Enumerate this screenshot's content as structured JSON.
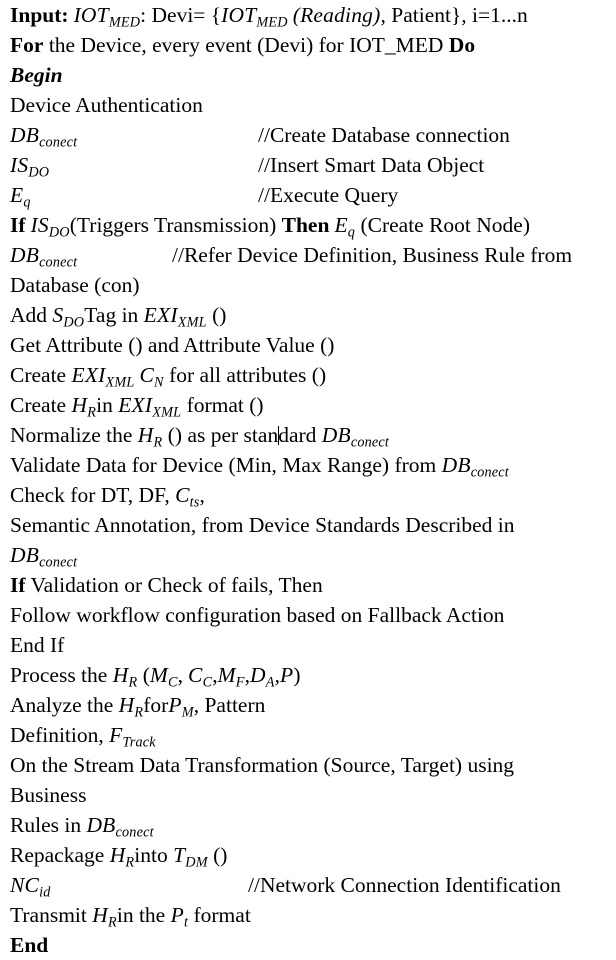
{
  "document": {
    "kind": "algorithm-pseudocode-listing",
    "font_style": "serif",
    "text_color": "#000000",
    "background_color": "#ffffff",
    "caret_visible": true,
    "caret_line_index": 15,
    "caret_after_text": "stan"
  },
  "lines": [
    {
      "id": "line-input",
      "code": "Input: IOT_MED : Devi= {IOT_MED (Reading), Patient}, i=1...n",
      "comment": ""
    },
    {
      "id": "line-for",
      "code": "For the Device, every event (Devi) for IOT_MED Do",
      "comment": ""
    },
    {
      "id": "line-begin",
      "code": "Begin",
      "comment": ""
    },
    {
      "id": "line-device-auth",
      "code": "Device Authentication",
      "comment": ""
    },
    {
      "id": "line-db-conect-1",
      "code": "DB_conect",
      "comment": "//Create Database connection"
    },
    {
      "id": "line-is-do",
      "code": "IS_DO",
      "comment": "//Insert Smart Data Object"
    },
    {
      "id": "line-eq",
      "code": "E_q",
      "comment": "//Execute Query"
    },
    {
      "id": "line-if-isdo",
      "code": "If IS_DO(Triggers Transmission) Then E_q (Create Root Node)",
      "comment": ""
    },
    {
      "id": "line-db-conect-2",
      "code": "DB_conect",
      "comment": "//Refer Device Definition, Business Rule from"
    },
    {
      "id": "line-database-con",
      "code": "Database (con)",
      "comment": ""
    },
    {
      "id": "line-add-sdo-tag",
      "code": "Add S_DO Tag in EXI_XML ()",
      "comment": ""
    },
    {
      "id": "line-get-attribute",
      "code": "Get Attribute () and Attribute Value ()",
      "comment": ""
    },
    {
      "id": "line-create-exi-cn",
      "code": "Create EXI_XML C_N for all attributes ()",
      "comment": ""
    },
    {
      "id": "line-create-hr",
      "code": "Create H_R in EXI_XML format ()",
      "comment": ""
    },
    {
      "id": "line-normalize",
      "code": "Normalize the H_R () as per standard DB_conect",
      "comment": ""
    },
    {
      "id": "line-validate",
      "code": "Validate Data for Device (Min, Max Range) from DB_conect",
      "comment": ""
    },
    {
      "id": "line-check-dt-df",
      "code": "Check for DT, DF, C_ts,",
      "comment": ""
    },
    {
      "id": "line-semantic-annotation",
      "code": "Semantic Annotation, from Device Standards Described in",
      "comment": ""
    },
    {
      "id": "line-db-conect-3",
      "code": "DB_conect",
      "comment": ""
    },
    {
      "id": "line-if-validation",
      "code": "If Validation or Check of fails, Then",
      "comment": ""
    },
    {
      "id": "line-follow-workflow",
      "code": "Follow workflow configuration based on Fallback Action",
      "comment": ""
    },
    {
      "id": "line-end-if",
      "code": "End If",
      "comment": ""
    },
    {
      "id": "line-process-hr",
      "code": "Process the H_R (M_C, C_C, M_F, D_A, P)",
      "comment": ""
    },
    {
      "id": "line-analyze-hr",
      "code": "Analyze the H_R for P_M, Pattern",
      "comment": ""
    },
    {
      "id": "line-definition-ftrack",
      "code": "Definition, F_Track",
      "comment": ""
    },
    {
      "id": "line-stream-transform",
      "code": "On the Stream Data Transformation (Source, Target) using",
      "comment": ""
    },
    {
      "id": "line-business",
      "code": "Business",
      "comment": ""
    },
    {
      "id": "line-rules-in-db",
      "code": "Rules in DB_conect",
      "comment": ""
    },
    {
      "id": "line-repackage",
      "code": "Repackage H_R into T_DM ()",
      "comment": ""
    },
    {
      "id": "line-nc-id",
      "code": "NC_id",
      "comment": "//Network Connection Identification"
    },
    {
      "id": "line-transmit",
      "code": "Transmit H_R in the P_t format",
      "comment": ""
    },
    {
      "id": "line-end",
      "code": "End",
      "comment": ""
    }
  ],
  "tokens": {
    "input_label": "Input:",
    "iot_med": "IOT",
    "iot_med_sub": "MED",
    "devi_eq": ": Devi= {",
    "reading": "(Reading)",
    "patient": ", Patient}, i=1...n",
    "for_label": "For",
    "for_rest": " the Device, every event (Devi) for IOT_MED ",
    "do_label": "Do",
    "begin_label": "Begin",
    "device_auth": "Device Authentication",
    "db": "DB",
    "conect": "conect",
    "is": "IS",
    "do_sub": "DO",
    "e": "E",
    "q_sub": "q",
    "if_label": "If",
    "triggers": "(Triggers Transmission) ",
    "then_label": "Then",
    "create_root_node": " (Create Root Node)",
    "database_con": "Database (con)",
    "add": "Add ",
    "s": "S",
    "tag_in": "Tag in ",
    "exi": "EXI",
    "xml_sub": "XML",
    "parens": " ()",
    "get_attribute": "Get Attribute () and Attribute Value ()",
    "create": "Create ",
    "c": "C",
    "n_sub": "N",
    "for_all_attributes": " for all attributes ()",
    "h": "H",
    "r_sub": "R",
    "in_word": "in ",
    "format": " format ()",
    "normalize_the": "Normalize the ",
    "as_per_standard_a": " () as per stan",
    "as_per_standard_b": "dard ",
    "validate": "Validate Data for Device (Min, Max Range) from ",
    "check_for": "Check for DT, DF, ",
    "ts_sub": "ts",
    "comma": ",",
    "semantic": "Semantic Annotation, from Device Standards Described in",
    "if_validation": " Validation or Check of fails, Then",
    "follow_workflow": "Follow workflow configuration based on Fallback Action",
    "end_if": "End If",
    "process_the": "Process the ",
    "open_paren": " (",
    "m": "M",
    "c_sub": "C",
    "f_sub": "F",
    "d": "D",
    "a_sub": "A",
    "p": "P",
    "close_paren": ")",
    "analyze_the": "Analyze the ",
    "for_word": "for",
    "m_sub": "M",
    "pattern": ", Pattern",
    "definition": "Definition, ",
    "f": "F",
    "track_sub": "Track",
    "stream_transform": "On the Stream Data Transformation (Source, Target) using",
    "business": "Business",
    "rules_in": "Rules in ",
    "repackage": "Repackage ",
    "into": "into ",
    "t": "T",
    "dm_sub": "DM",
    "nc": "NC",
    "id_sub": "id",
    "transmit": "Transmit ",
    "in_the": "in the ",
    "t_sub": "t",
    "format_word": " format",
    "end_label": "End",
    "comment_create_db": "//Create Database connection",
    "comment_insert_sdo": "//Insert Smart Data Object",
    "comment_execute_query": "//Execute Query",
    "comment_refer_device": "//Refer Device Definition, Business Rule from",
    "comment_network": "//Network Connection Identification"
  }
}
